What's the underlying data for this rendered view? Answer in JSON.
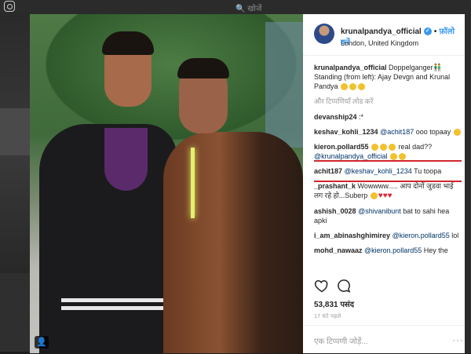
{
  "background": {
    "search_text": "🔍 खोजें"
  },
  "post": {
    "username": "krunalpandya_official",
    "dot": "•",
    "follow_label": "फ़ॉलो करें",
    "location": "London, United Kingdom",
    "caption_user": "krunalpandya_official",
    "caption_text": "Doppelganger👬 Standing (from left): Ajay Devgn and Krunal Pandya",
    "load_more": "और टिप्पणियाँ लोड करें",
    "comments": [
      {
        "user": "devanship24",
        "text": ":*"
      },
      {
        "user": "keshav_kohli_1234",
        "mention": "@achit187",
        "text": "ooo topaay"
      },
      {
        "user": "kieron.pollard55",
        "text": "real dad??",
        "mention2": "@krunalpandya_official"
      },
      {
        "user": "achit187",
        "mention": "@keshav_kohli_1234",
        "text": "Tu toopa"
      },
      {
        "user": "_prashant_k",
        "text": "Wowwww..... आप दोनों जुडवा भाई लग रहे हो...Suberp"
      },
      {
        "user": "ashish_0028",
        "mention": "@shivanibunt",
        "text": "bat to sahi hea apki"
      },
      {
        "user": "i_am_abinashghimirey",
        "mention": "@kieron.pollard55",
        "text": "lol"
      },
      {
        "user": "mohd_nawaaz",
        "mention": "@kieron.pollard55",
        "text": "Hey the"
      }
    ],
    "likes": "53,831 पसंद",
    "time": "17 घंटे पहले",
    "add_comment_placeholder": "एक टिप्पणी जोड़ें...",
    "more": "···"
  },
  "icons": [
    "instagram-icon",
    "verified-icon",
    "heart-icon",
    "comment-icon",
    "user-tag-icon"
  ],
  "colors": {
    "accent": "#3897f0",
    "highlight": "#d0262e",
    "text": "#262626"
  }
}
